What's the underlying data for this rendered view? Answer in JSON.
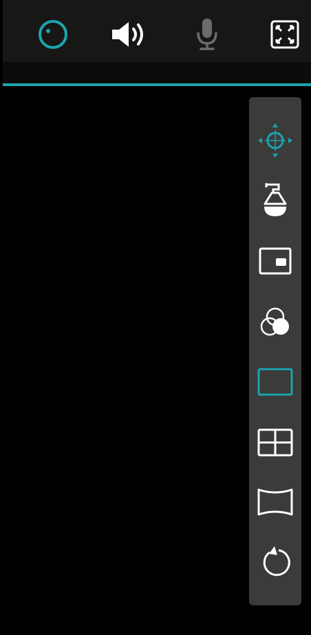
{
  "colors": {
    "accent": "#1aa5b0",
    "icon_white": "#ffffff",
    "icon_disabled": "#6b6b6b",
    "toolbar_bg": "#171715",
    "panel_bg": "#3b3b39",
    "video_bg": "#000000"
  },
  "top_toolbar": {
    "items": [
      {
        "icon": "record-icon",
        "state": "active"
      },
      {
        "icon": "speaker-icon",
        "state": "on"
      },
      {
        "icon": "microphone-icon",
        "state": "disabled"
      },
      {
        "icon": "fullscreen-icon",
        "state": "normal"
      }
    ]
  },
  "side_panel": {
    "items": [
      {
        "icon": "ptz-direction-icon",
        "state": "active"
      },
      {
        "icon": "dome-camera-icon",
        "state": "normal"
      },
      {
        "icon": "picture-in-picture-icon",
        "state": "normal"
      },
      {
        "icon": "color-adjust-icon",
        "state": "normal"
      },
      {
        "icon": "single-view-icon",
        "state": "selected"
      },
      {
        "icon": "quad-view-icon",
        "state": "normal"
      },
      {
        "icon": "panorama-icon",
        "state": "normal"
      },
      {
        "icon": "rotate-icon",
        "state": "normal"
      }
    ]
  }
}
